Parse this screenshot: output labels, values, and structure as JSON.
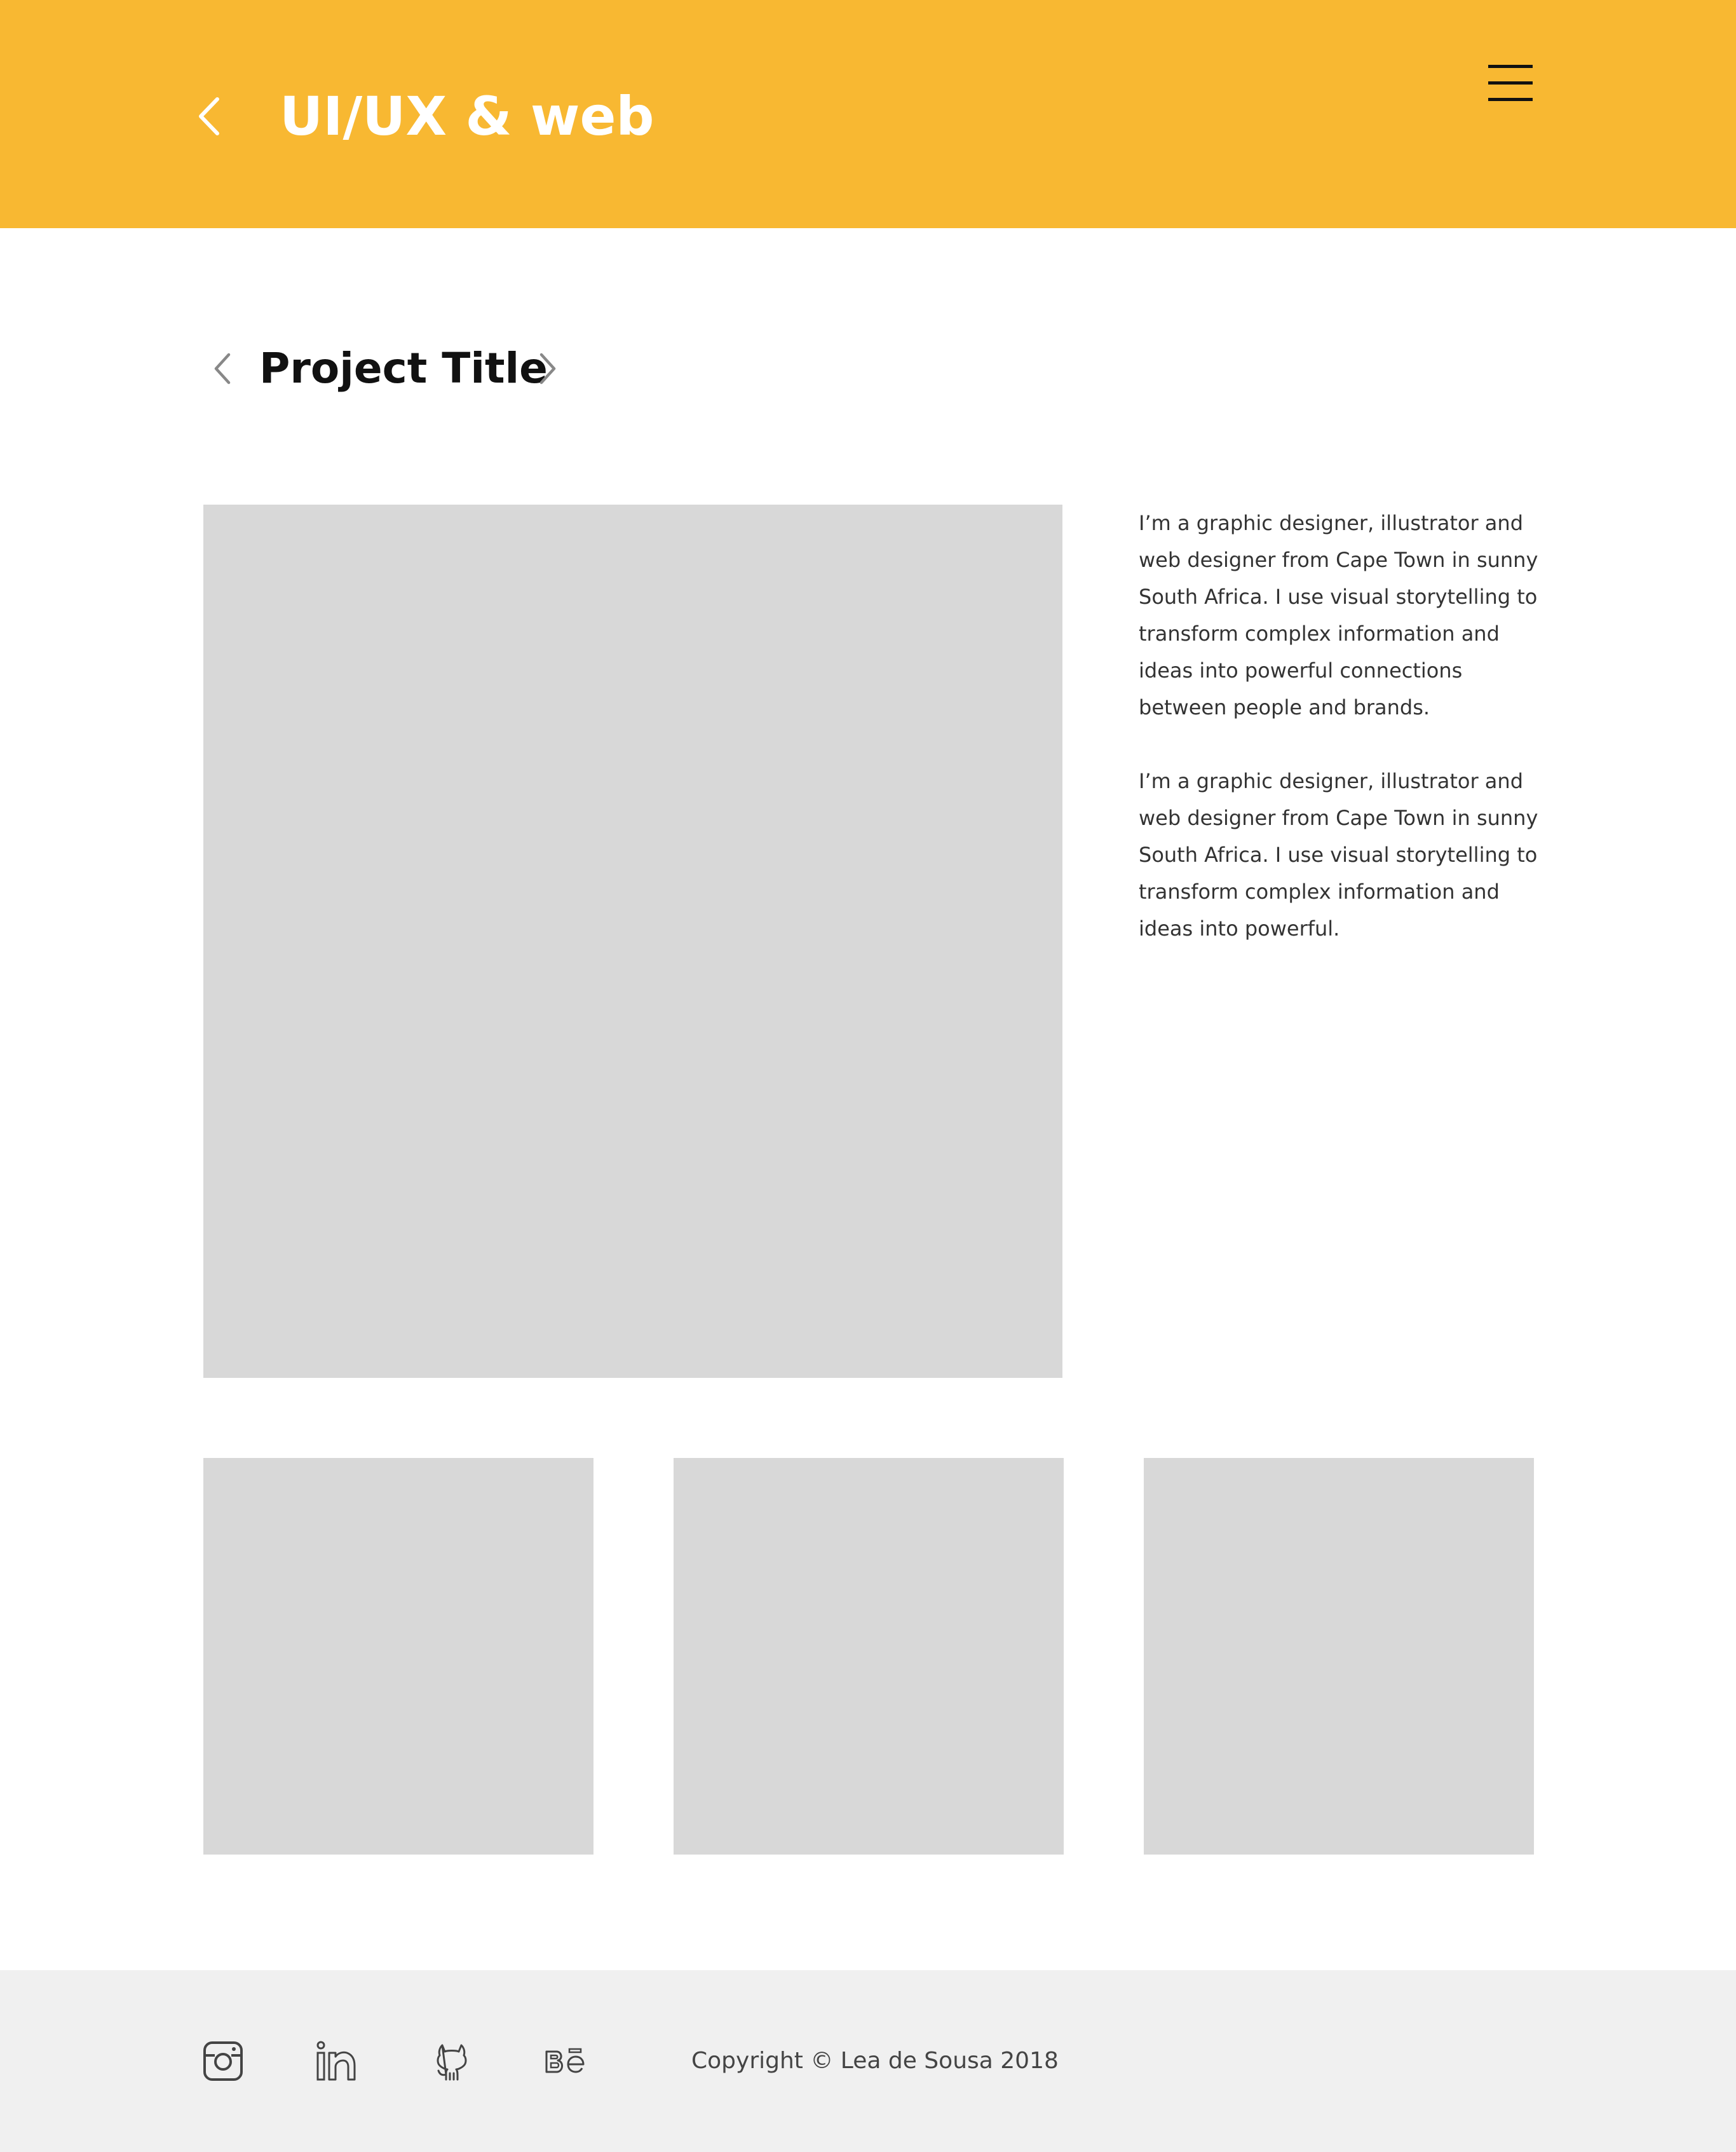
{
  "colors": {
    "header_bg": "#F8B832",
    "placeholder": "#D8D8D8",
    "footer_bg": "#F0F0F0",
    "text_dark": "#111111",
    "text_body": "#333333"
  },
  "header": {
    "title": "UI/UX & web",
    "back_icon": "chevron-left-icon",
    "menu_icon": "hamburger-menu-icon"
  },
  "project": {
    "title": "Project Title",
    "prev_icon": "chevron-left-icon",
    "next_icon": "chevron-right-icon"
  },
  "description": {
    "paragraphs": [
      "I’m a graphic designer, illustrator and web designer from Cape Town in sunny South Africa. I use visual storytelling to transform complex information and ideas into powerful connections between people and brands.",
      "I’m a graphic designer, illustrator and web designer from Cape Town in sunny South Africa. I use visual storytelling to transform complex information and ideas into powerful."
    ]
  },
  "footer": {
    "social": [
      {
        "name": "instagram",
        "icon": "instagram-icon"
      },
      {
        "name": "linkedin",
        "icon": "linkedin-icon"
      },
      {
        "name": "github",
        "icon": "github-icon"
      },
      {
        "name": "behance",
        "icon": "behance-icon"
      }
    ],
    "copyright": "Copyright © Lea de Sousa 2018"
  }
}
